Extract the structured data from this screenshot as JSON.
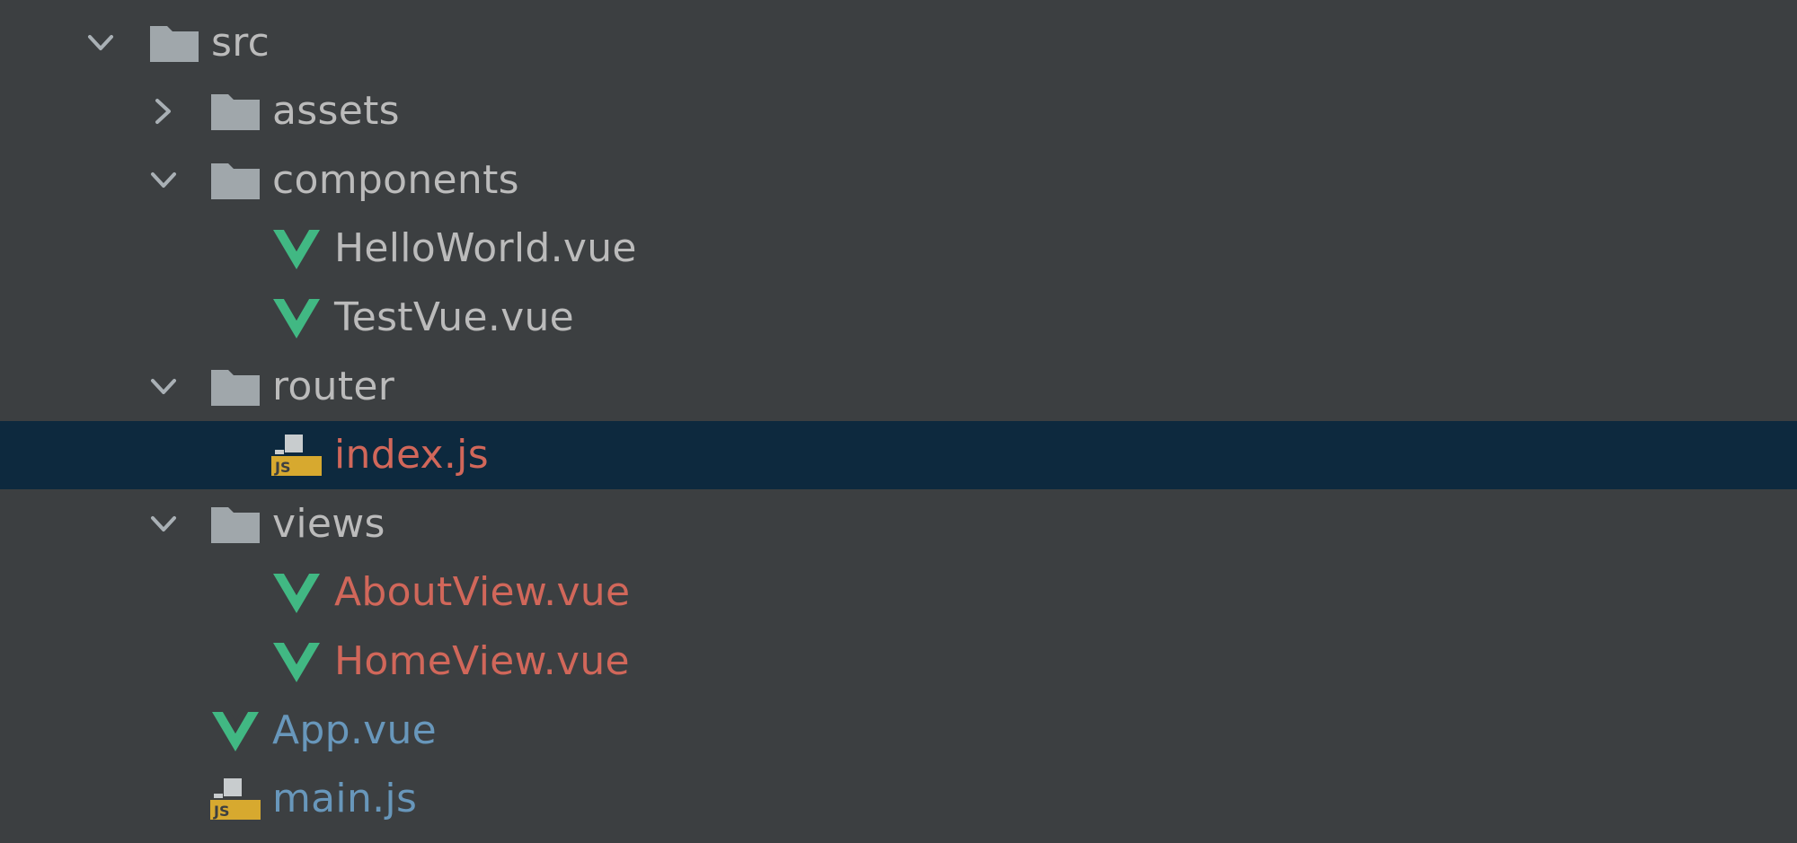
{
  "colors": {
    "background": "#3c3f41",
    "selection": "#0d293e",
    "text_normal": "#bbbbbb",
    "text_modified": "#6897bb",
    "text_unversioned": "#d1675a",
    "folder_icon": "#a0a7ab",
    "vue_green": "#41b883",
    "vue_dark": "#34495e",
    "js_badge": "#d7a92f"
  },
  "tree": {
    "items": [
      {
        "label": "src",
        "type": "folder",
        "expanded": true,
        "level": 0,
        "status": "normal"
      },
      {
        "label": "assets",
        "type": "folder",
        "expanded": false,
        "level": 1,
        "status": "normal"
      },
      {
        "label": "components",
        "type": "folder",
        "expanded": true,
        "level": 1,
        "status": "normal"
      },
      {
        "label": "HelloWorld.vue",
        "type": "vue",
        "level": 2,
        "status": "normal"
      },
      {
        "label": "TestVue.vue",
        "type": "vue",
        "level": 2,
        "status": "normal"
      },
      {
        "label": "router",
        "type": "folder",
        "expanded": true,
        "level": 1,
        "status": "normal"
      },
      {
        "label": "index.js",
        "type": "js",
        "level": 2,
        "status": "unversioned",
        "selected": true
      },
      {
        "label": "views",
        "type": "folder",
        "expanded": true,
        "level": 1,
        "status": "normal"
      },
      {
        "label": "AboutView.vue",
        "type": "vue",
        "level": 2,
        "status": "unversioned"
      },
      {
        "label": "HomeView.vue",
        "type": "vue",
        "level": 2,
        "status": "unversioned"
      },
      {
        "label": "App.vue",
        "type": "vue",
        "level": 1,
        "status": "modified"
      },
      {
        "label": "main.js",
        "type": "js",
        "level": 1,
        "status": "modified"
      }
    ]
  }
}
